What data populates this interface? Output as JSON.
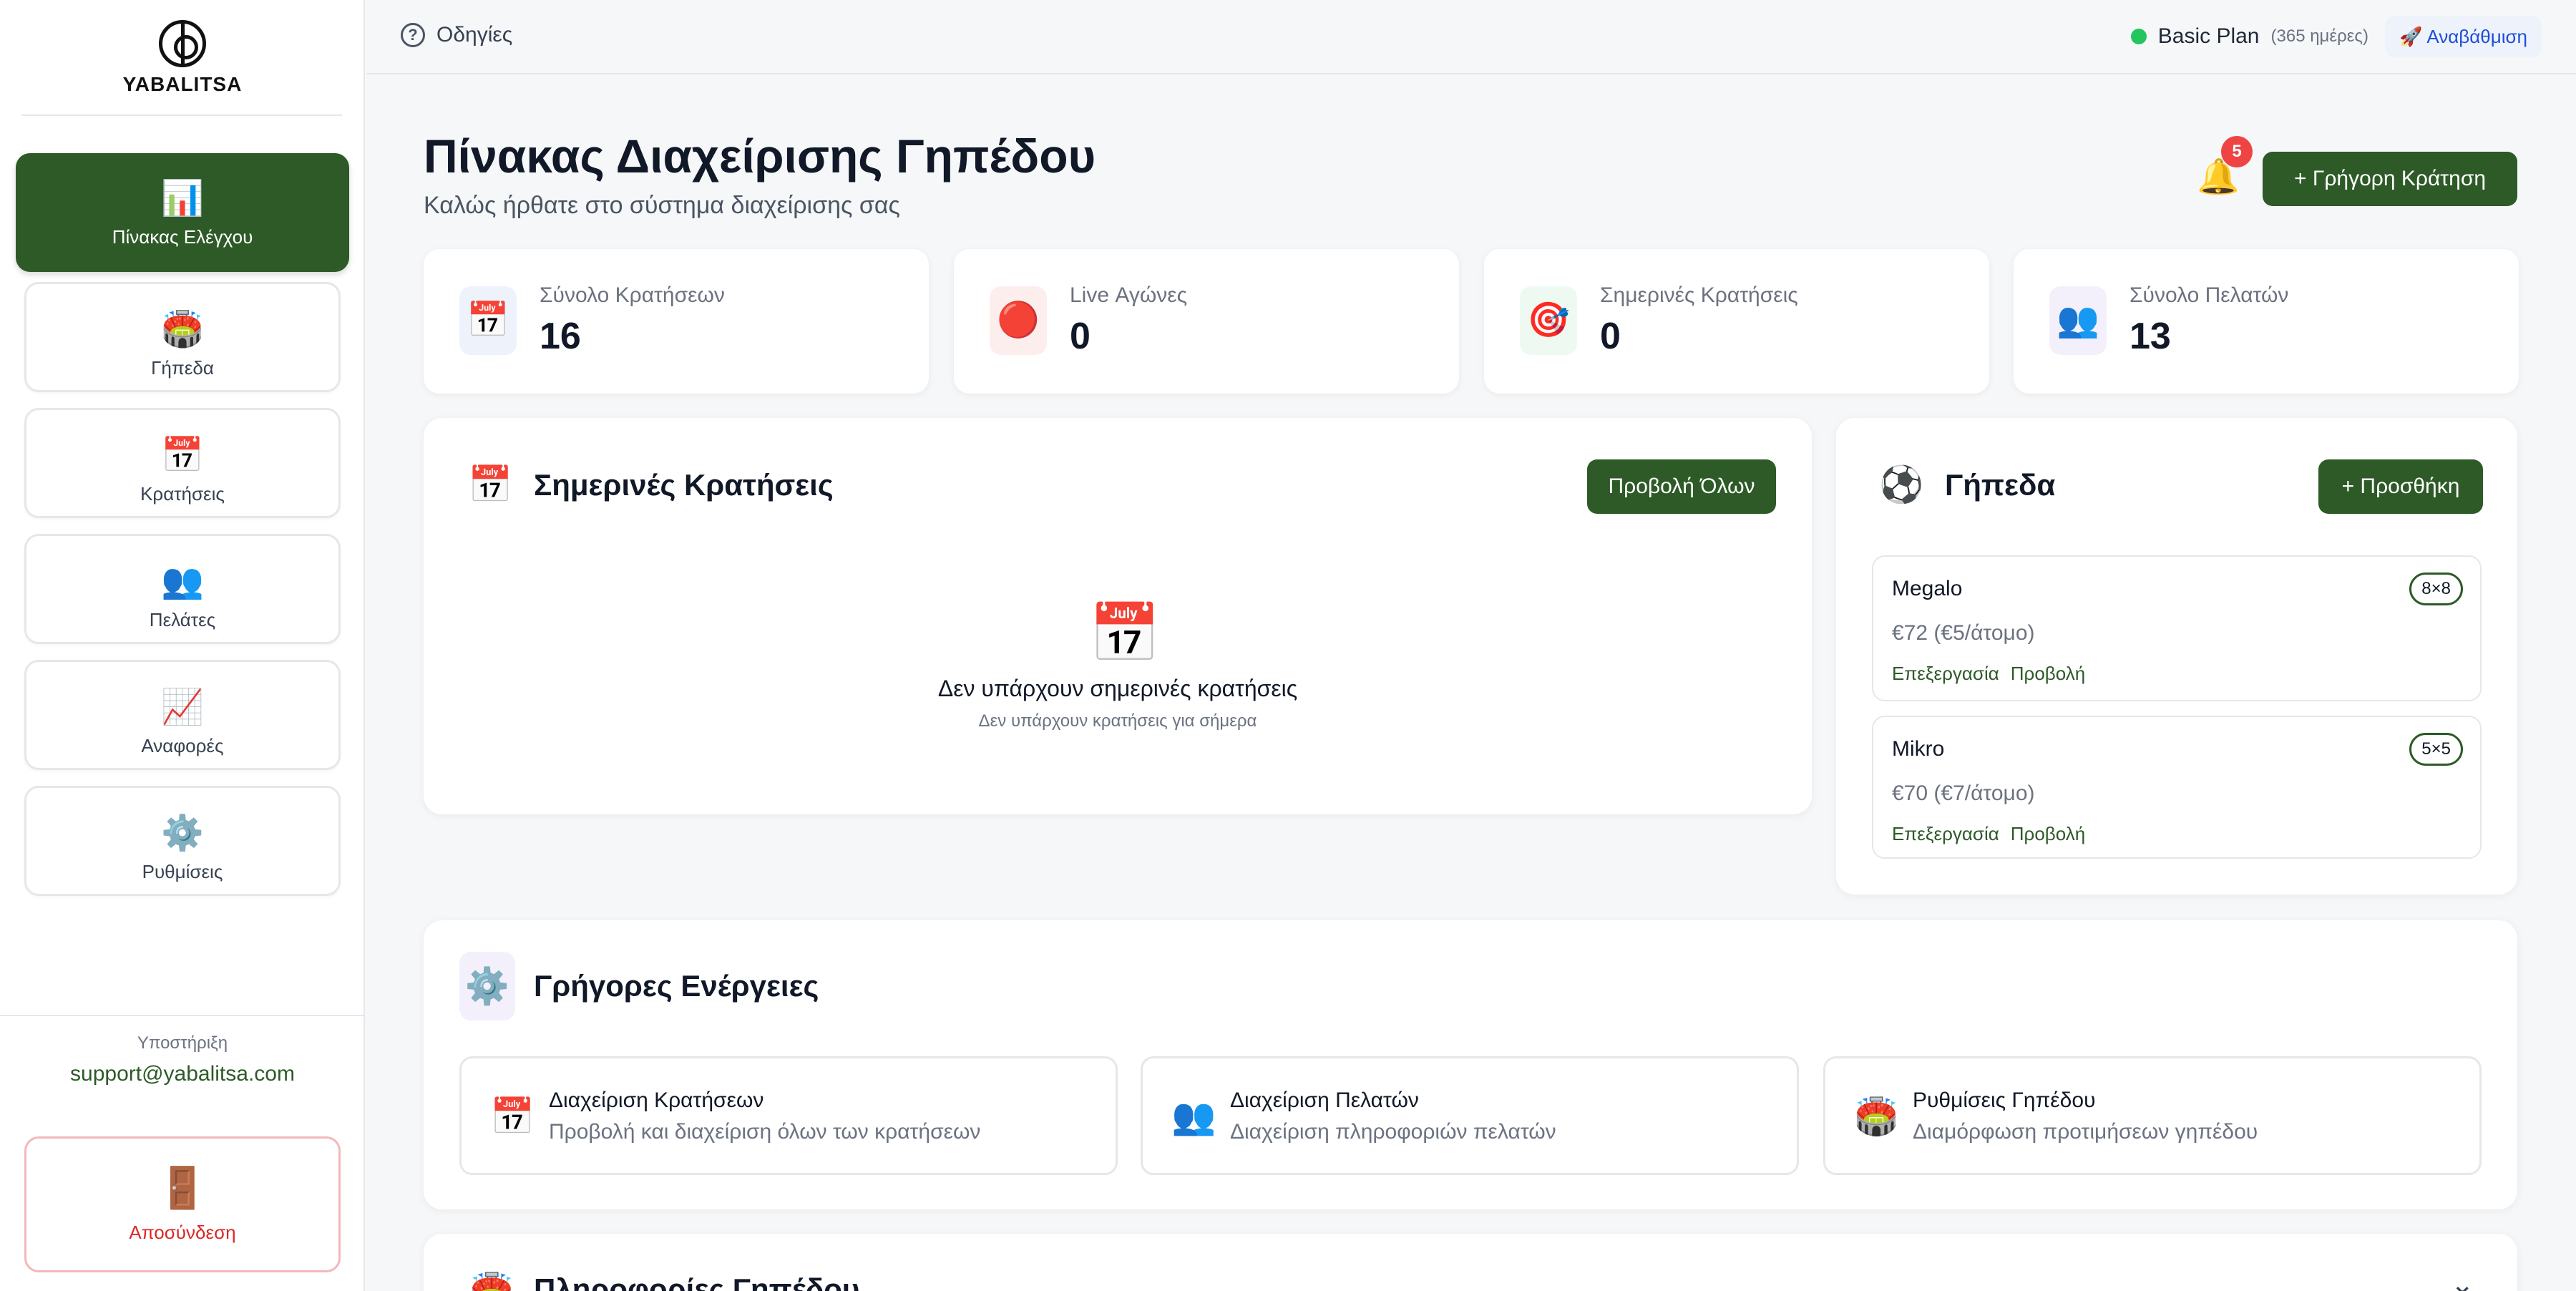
{
  "app": {
    "name": "YABALITSA"
  },
  "sidebar": {
    "items": [
      {
        "label": "Πίνακας Ελέγχου",
        "icon": "📊"
      },
      {
        "label": "Γήπεδα",
        "icon": "🏟️"
      },
      {
        "label": "Κρατήσεις",
        "icon": "📅"
      },
      {
        "label": "Πελάτες",
        "icon": "👥"
      },
      {
        "label": "Αναφορές",
        "icon": "📈"
      },
      {
        "label": "Ρυθμίσεις",
        "icon": "⚙️"
      }
    ],
    "support_label": "Υποστήριξη",
    "support_email": "support@yabalitsa.com",
    "logout_label": "Αποσύνδεση",
    "logout_icon": "🚪"
  },
  "topbar": {
    "help_label": "Οδηγίες",
    "help_icon": "?",
    "plan_name": "Basic Plan",
    "plan_days": "(365 ημέρες)",
    "upgrade_label": "🚀 Αναβάθμιση",
    "plan_status_color": "#22c55e"
  },
  "header": {
    "title": "Πίνακας Διαχείρισης Γηπέδου",
    "subtitle": "Καλώς ήρθατε στο σύστημα διαχείρισης σας",
    "notifications_count": "5",
    "bell_icon": "🔔",
    "quick_book_label": "+  Γρήγορη Κράτηση"
  },
  "stats": [
    {
      "label": "Σύνολο Κρατήσεων",
      "value": "16",
      "icon": "📅",
      "bg": "#eef2fb"
    },
    {
      "label": "Live Αγώνες",
      "value": "0",
      "icon": "🔴",
      "bg": "#fdeeee"
    },
    {
      "label": "Σημερινές Κρατήσεις",
      "value": "0",
      "icon": "🎯",
      "bg": "#eefaf1"
    },
    {
      "label": "Σύνολο Πελατών",
      "value": "13",
      "icon": "👥",
      "bg": "#f3f0fb"
    }
  ],
  "today": {
    "title": "Σημερινές Κρατήσεις",
    "icon": "📅",
    "view_all_label": "Προβολή Όλων",
    "empty_icon": "📅",
    "empty_title": "Δεν υπάρχουν σημερινές κρατήσεις",
    "empty_subtitle": "Δεν υπάρχουν κρατήσεις για σήμερα"
  },
  "courts": {
    "title": "Γήπεδα",
    "icon": "⚽",
    "add_label": "+ Προσθήκη",
    "items": [
      {
        "name": "Megalo",
        "size": "8×8",
        "price": "€72 (€5/άτομο)",
        "edit": "Επεξεργασία",
        "view": "Προβολή"
      },
      {
        "name": "Mikro",
        "size": "5×5",
        "price": "€70 (€7/άτομο)",
        "edit": "Επεξεργασία",
        "view": "Προβολή"
      }
    ]
  },
  "quick_actions": {
    "title": "Γρήγορες Ενέργειες",
    "icon": "⚙️",
    "items": [
      {
        "title": "Διαχείριση Κρατήσεων",
        "desc": "Προβολή και διαχείριση όλων των κρατήσεων",
        "icon": "📅"
      },
      {
        "title": "Διαχείριση Πελατών",
        "desc": "Διαχείριση πληροφοριών πελατών",
        "icon": "👥"
      },
      {
        "title": "Ρυθμίσεις Γηπέδου",
        "desc": "Διαμόρφωση προτιμήσεων γηπέδου",
        "icon": "🏟️"
      }
    ]
  },
  "info": {
    "title": "Πληροφορίες Γηπέδου",
    "icon": "🏟️",
    "chevron": "⌄"
  }
}
